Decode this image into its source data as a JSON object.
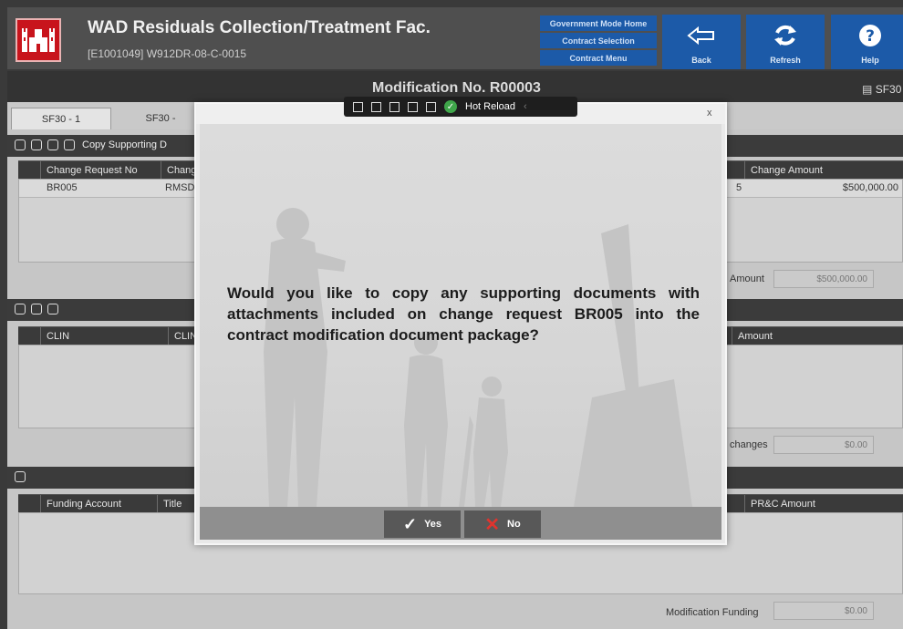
{
  "header": {
    "title": "WAD Residuals Collection/Treatment Fac.",
    "subtitle": "[E1001049] W912DR-08-C-0015",
    "nav_links": [
      "Government Mode Home",
      "Contract Selection",
      "Contract Menu"
    ],
    "back_label": "Back",
    "refresh_label": "Refresh",
    "help_label": "Help",
    "accent_color": "#1c5aa8",
    "logo_color": "#c8141c"
  },
  "modification": {
    "title": "Modification No.  R00003",
    "sf30_label": "SF30"
  },
  "tabs": [
    "SF30 - 1",
    "SF30 -"
  ],
  "change_request_panel": {
    "toolbar_label": "Copy Supporting D",
    "columns": [
      "Change Request No",
      "Chang",
      "Change Amount"
    ],
    "rows": [
      {
        "request_no": "BR005",
        "change": "RMSD",
        "col_partial": "5",
        "amount": "$500,000.00"
      }
    ],
    "amount_label": "Amount",
    "amount_value": "$500,000.00"
  },
  "clin_panel": {
    "columns": [
      "CLIN",
      "CLIN",
      "Amount"
    ],
    "changes_label": "changes",
    "changes_value": "$0.00"
  },
  "funding_panel": {
    "columns": [
      "Funding Account",
      "Title",
      "PR&C Amount"
    ],
    "funding_label": "Modification Funding",
    "funding_value": "$0.00"
  },
  "debug_toolbar": {
    "hot_reload_label": "Hot Reload"
  },
  "dialog": {
    "close_label": "x",
    "question": "Would you like to copy any supporting documents with attachments included on change request BR005 into the contract modification document package?",
    "yes_label": "Yes",
    "no_label": "No"
  }
}
